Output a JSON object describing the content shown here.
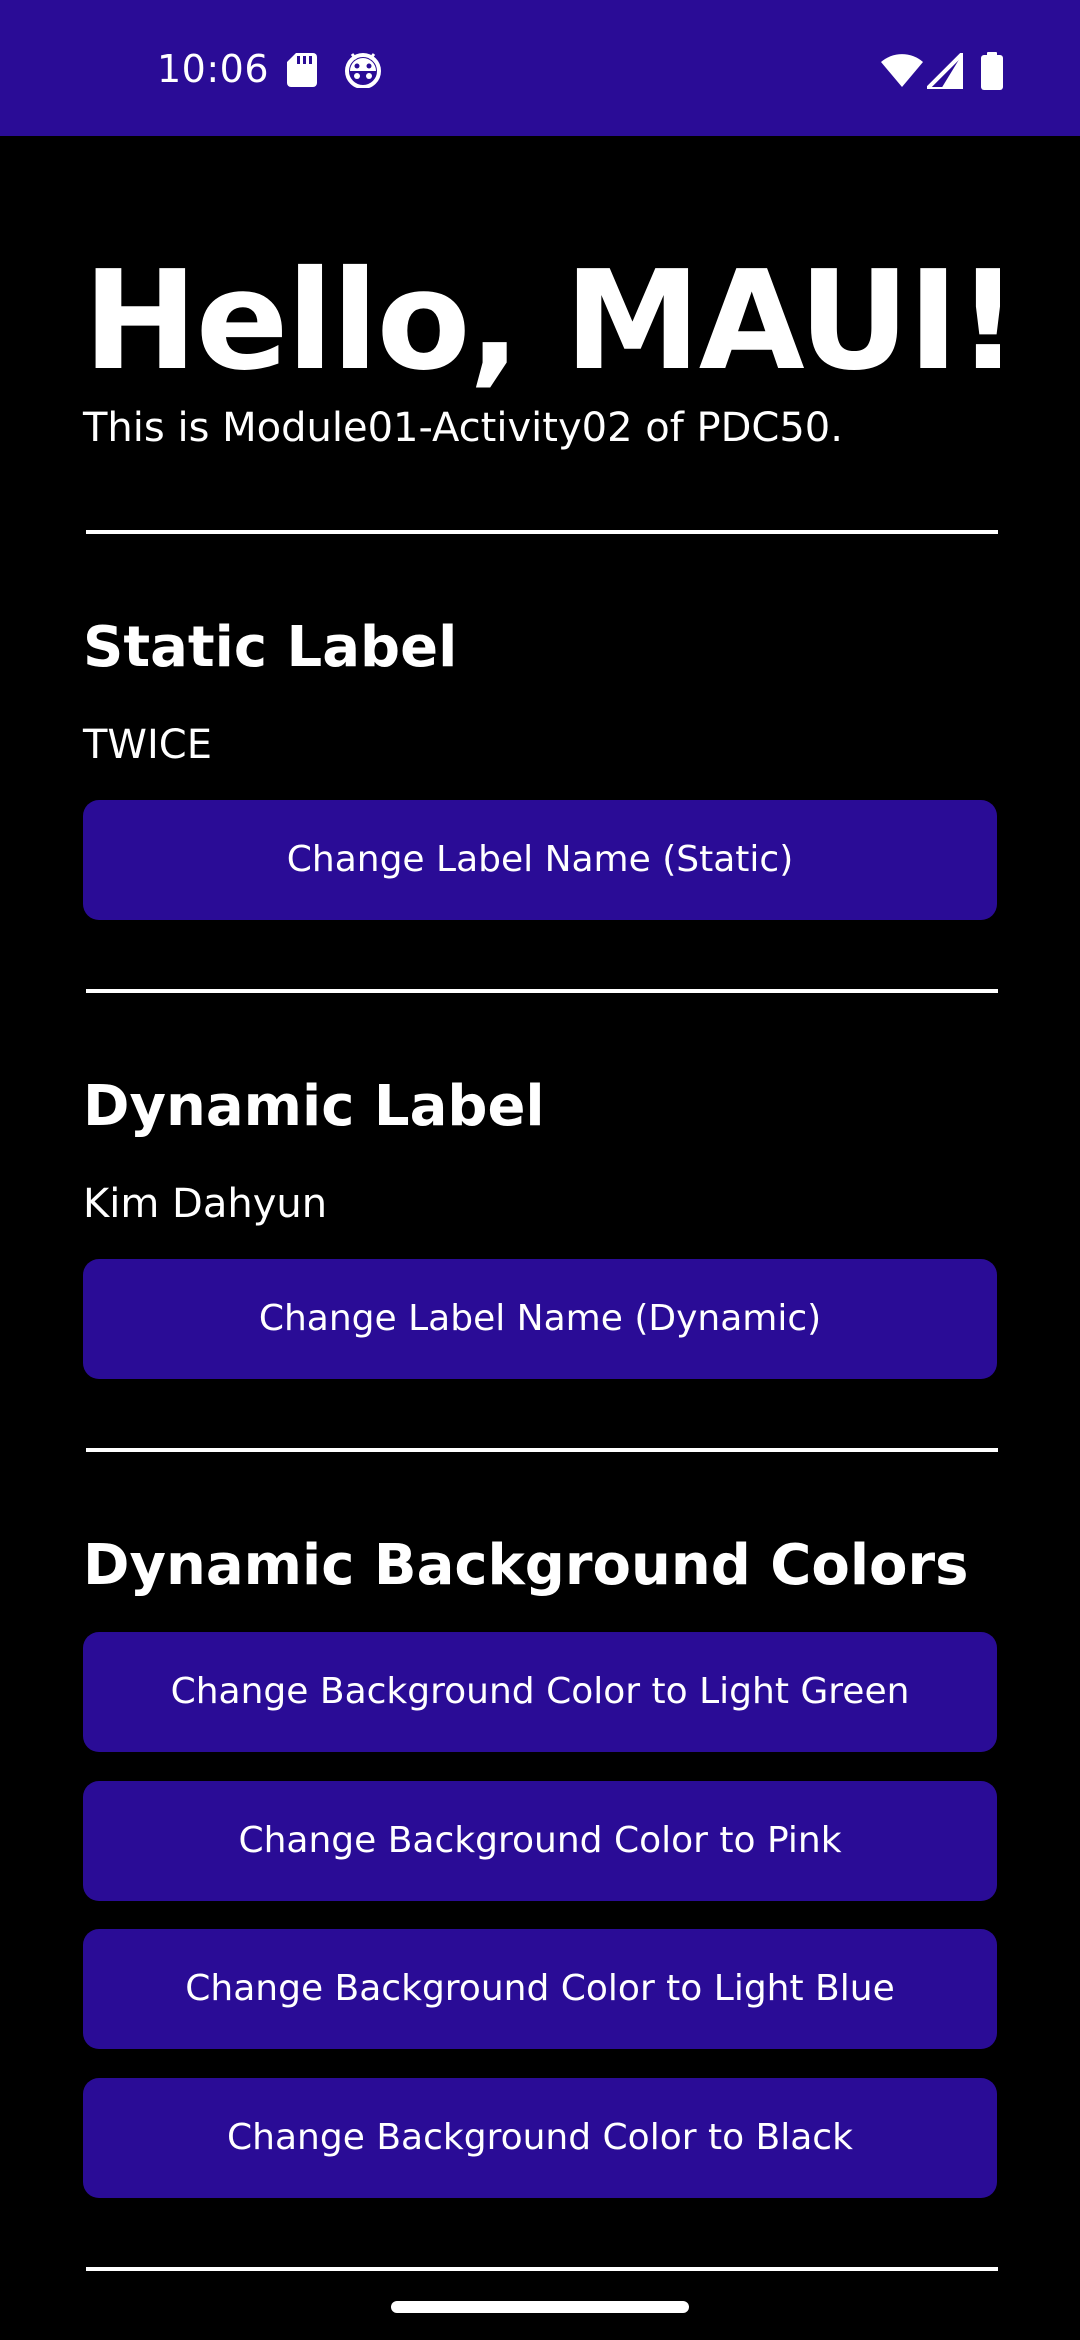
{
  "status_bar": {
    "time": "10:06",
    "background_color": "#2a0c96",
    "left_icons": [
      "sd-card-icon",
      "bug-icon"
    ],
    "right_icons": [
      "wifi-icon",
      "signal-icon",
      "battery-icon"
    ]
  },
  "header": {
    "title": "Hello, MAUI!",
    "subtitle": "This is Module01-Activity02 of PDC50."
  },
  "static_section": {
    "title": "Static Label",
    "label_value": "TWICE",
    "button_label": "Change Label Name (Static)"
  },
  "dynamic_section": {
    "title": "Dynamic Label",
    "label_value": "Kim Dahyun",
    "button_label": "Change Label Name (Dynamic)"
  },
  "background_section": {
    "title": "Dynamic Background Colors",
    "buttons": [
      {
        "label": "Change Background Color to Light Green"
      },
      {
        "label": "Change Background Color to Pink"
      },
      {
        "label": "Change Background Color to Light Blue"
      },
      {
        "label": "Change Background Color to Black"
      }
    ]
  },
  "colors": {
    "button_background": "#2a0c96",
    "page_background": "#000000",
    "text": "#ffffff"
  }
}
